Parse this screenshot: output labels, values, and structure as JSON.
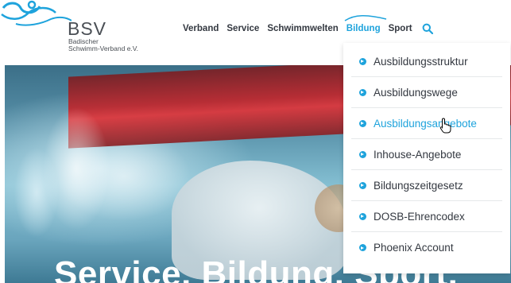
{
  "logo": {
    "acronym": "BSV",
    "line1": "Badischer",
    "line2": "Schwimm-Verband e.V."
  },
  "nav": {
    "items": [
      "Verband",
      "Service",
      "Schwimmwelten",
      "Bildung",
      "Sport"
    ],
    "active_index": 3
  },
  "dropdown": {
    "items": [
      "Ausbildungsstruktur",
      "Ausbildungswege",
      "Ausbildungsangebote",
      "Inhouse-Angebote",
      "Bildungszeitgesetz",
      "DOSB-Ehrencodex",
      "Phoenix Account"
    ],
    "hover_index": 2
  },
  "hero": {
    "title": "Service. Bildung. Sport."
  },
  "colors": {
    "accent": "#1ea3dc",
    "text": "#333840"
  }
}
